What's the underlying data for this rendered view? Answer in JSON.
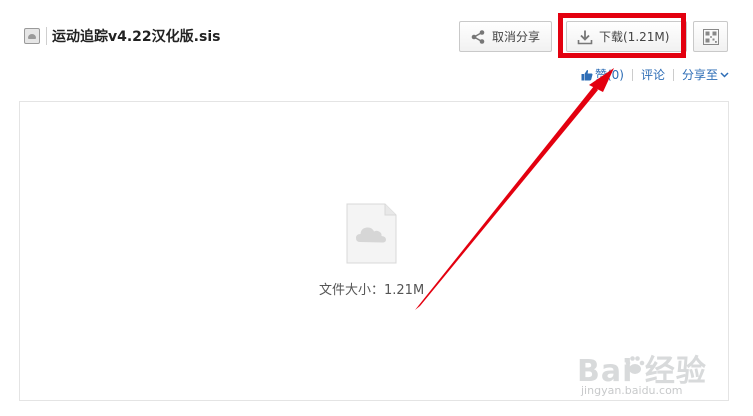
{
  "file": {
    "title": "运动追踪v4.22汉化版.sis",
    "size_label": "文件大小：1.21M"
  },
  "toolbar": {
    "cancel_share_label": "取消分享",
    "download_label": "下载(1.21M)",
    "qrcode_icon": "qrcode-icon"
  },
  "meta": {
    "like_label": "赞(0)",
    "comment_label": "评论",
    "share_to_label": "分享至"
  },
  "watermark": {
    "brand": "Bai 经验",
    "url": "jingyan.baidu.com"
  },
  "colors": {
    "highlight_red": "#e3000f",
    "link_blue": "#2d6db6",
    "icon_gray": "#cccccc"
  }
}
